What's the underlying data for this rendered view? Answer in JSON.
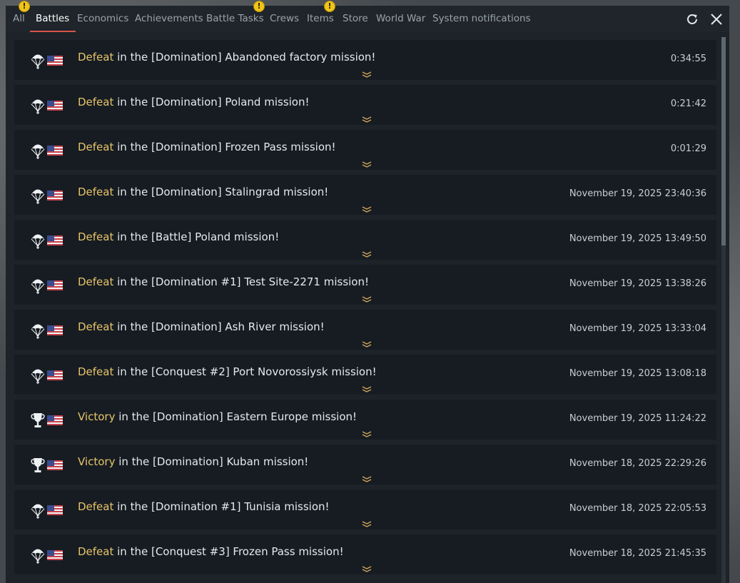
{
  "tabs": [
    {
      "label": "All",
      "badge": "!"
    },
    {
      "label": "Battles",
      "active": true
    },
    {
      "label": "Economics"
    },
    {
      "label": "Achievements"
    },
    {
      "label": "Battle Tasks",
      "badge": "!"
    },
    {
      "label": "Crews"
    },
    {
      "label": "Items",
      "badge": "!"
    },
    {
      "label": "Store"
    },
    {
      "label": "World War"
    },
    {
      "label": "System notifications"
    }
  ],
  "toolbar": {
    "refresh_icon": "refresh-icon",
    "close_icon": "close-icon"
  },
  "colors": {
    "defeat_victory_text": "#e8c46a",
    "active_tab_underline": "#d9534a",
    "badge": "#f0c419"
  },
  "rows": [
    {
      "icon": "parachute-icon",
      "result": "Defeat",
      "text": " in the [Domination] Abandoned factory mission!",
      "time": "0:34:55"
    },
    {
      "icon": "parachute-icon",
      "result": "Defeat",
      "text": " in the [Domination] Poland mission!",
      "time": "0:21:42"
    },
    {
      "icon": "parachute-icon",
      "result": "Defeat",
      "text": " in the [Domination] Frozen Pass mission!",
      "time": "0:01:29"
    },
    {
      "icon": "parachute-icon",
      "result": "Defeat",
      "text": " in the [Domination] Stalingrad mission!",
      "time": "November 19, 2025 23:40:36"
    },
    {
      "icon": "parachute-icon",
      "result": "Defeat",
      "text": " in the [Battle] Poland mission!",
      "time": "November 19, 2025 13:49:50"
    },
    {
      "icon": "parachute-icon",
      "result": "Defeat",
      "text": " in the [Domination #1] Test Site-2271 mission!",
      "time": "November 19, 2025 13:38:26"
    },
    {
      "icon": "parachute-icon",
      "result": "Defeat",
      "text": " in the [Domination] Ash River mission!",
      "time": "November 19, 2025 13:33:04"
    },
    {
      "icon": "parachute-icon",
      "result": "Defeat",
      "text": " in the [Conquest #2] Port Novorossiysk mission!",
      "time": "November 19, 2025 13:08:18"
    },
    {
      "icon": "trophy-icon",
      "result": "Victory",
      "text": " in the [Domination] Eastern Europe mission!",
      "time": "November 19, 2025 11:24:22"
    },
    {
      "icon": "trophy-icon",
      "result": "Victory",
      "text": " in the [Domination] Kuban mission!",
      "time": "November 18, 2025 22:29:26"
    },
    {
      "icon": "parachute-icon",
      "result": "Defeat",
      "text": " in the [Domination #1] Tunisia mission!",
      "time": "November 18, 2025 22:05:53"
    },
    {
      "icon": "parachute-icon",
      "result": "Defeat",
      "text": " in the [Conquest #3] Frozen Pass mission!",
      "time": "November 18, 2025 21:45:35"
    }
  ]
}
